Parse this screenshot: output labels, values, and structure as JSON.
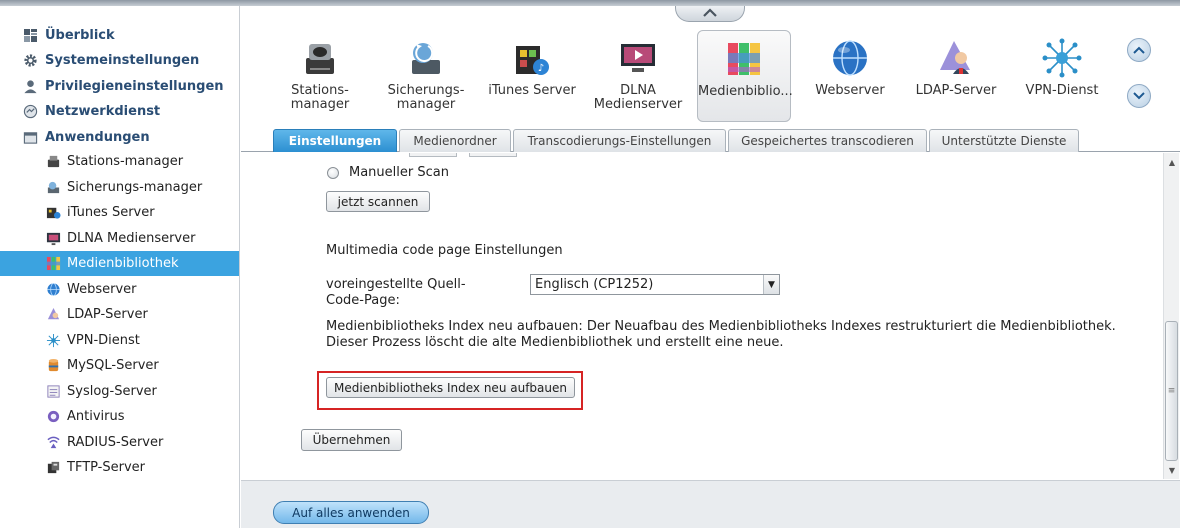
{
  "sidebar": {
    "top_items": [
      {
        "label": "Überblick",
        "icon": "overview-icon"
      },
      {
        "label": "Systemeinstellungen",
        "icon": "gear-icon"
      },
      {
        "label": "Privilegieneinstellungen",
        "icon": "user-icon"
      },
      {
        "label": "Netzwerkdienst",
        "icon": "network-icon"
      },
      {
        "label": "Anwendungen",
        "icon": "applications-icon"
      }
    ],
    "sub_items": [
      {
        "label": "Stations-manager",
        "icon": "station-manager-icon"
      },
      {
        "label": "Sicherungs-manager",
        "icon": "backup-manager-icon"
      },
      {
        "label": "iTunes Server",
        "icon": "itunes-icon"
      },
      {
        "label": "DLNA Medienserver",
        "icon": "dlna-icon"
      },
      {
        "label": "Medienbibliothek",
        "icon": "media-library-icon",
        "active": true
      },
      {
        "label": "Webserver",
        "icon": "globe-icon"
      },
      {
        "label": "LDAP-Server",
        "icon": "ldap-icon"
      },
      {
        "label": "VPN-Dienst",
        "icon": "vpn-icon"
      },
      {
        "label": "MySQL-Server",
        "icon": "mysql-icon"
      },
      {
        "label": "Syslog-Server",
        "icon": "syslog-icon"
      },
      {
        "label": "Antivirus",
        "icon": "antivirus-icon"
      },
      {
        "label": "RADIUS-Server",
        "icon": "radius-icon"
      },
      {
        "label": "TFTP-Server",
        "icon": "tftp-icon"
      }
    ]
  },
  "apps": [
    {
      "label": "Stations-\nmanager",
      "icon": "station-manager-icon"
    },
    {
      "label": "Sicherungs-\nmanager",
      "icon": "backup-manager-icon"
    },
    {
      "label": "iTunes Server",
      "icon": "itunes-icon"
    },
    {
      "label": "DLNA\nMedienserver",
      "icon": "dlna-icon"
    },
    {
      "label": "Medienbiblio...",
      "icon": "media-library-icon",
      "active": true
    },
    {
      "label": "Webserver",
      "icon": "globe-icon"
    },
    {
      "label": "LDAP-Server",
      "icon": "ldap-icon"
    },
    {
      "label": "VPN-Dienst",
      "icon": "vpn-icon"
    }
  ],
  "tabs": [
    {
      "label": "Einstellungen",
      "active": true
    },
    {
      "label": "Medienordner"
    },
    {
      "label": "Transcodierungs-Einstellungen"
    },
    {
      "label": "Gespeichertes transcodieren"
    },
    {
      "label": "Unterstützte Dienste"
    }
  ],
  "content": {
    "manual_scan_label": "Manueller Scan",
    "scan_now_button": "jetzt scannen",
    "codepage_heading": "Multimedia code page Einstellungen",
    "codepage_label": "voreingestellte Quell-\nCode-Page:",
    "codepage_value": "Englisch (CP1252)",
    "rebuild_description": "Medienbibliotheks Index neu aufbauen: Der Neuafbau des Medienbibliotheks Indexes restrukturiert die Medienbibliothek.\nDieser Prozess löscht die alte Medienbibliothek und erstellt eine neue.",
    "rebuild_button": "Medienbibliotheks Index neu aufbauen",
    "apply_button": "Übernehmen"
  },
  "footer": {
    "apply_all_button": "Auf alles anwenden"
  },
  "colors": {
    "active_blue": "#3ba3e0",
    "nav_text": "#2a4d74",
    "highlight_red": "#d62424"
  }
}
